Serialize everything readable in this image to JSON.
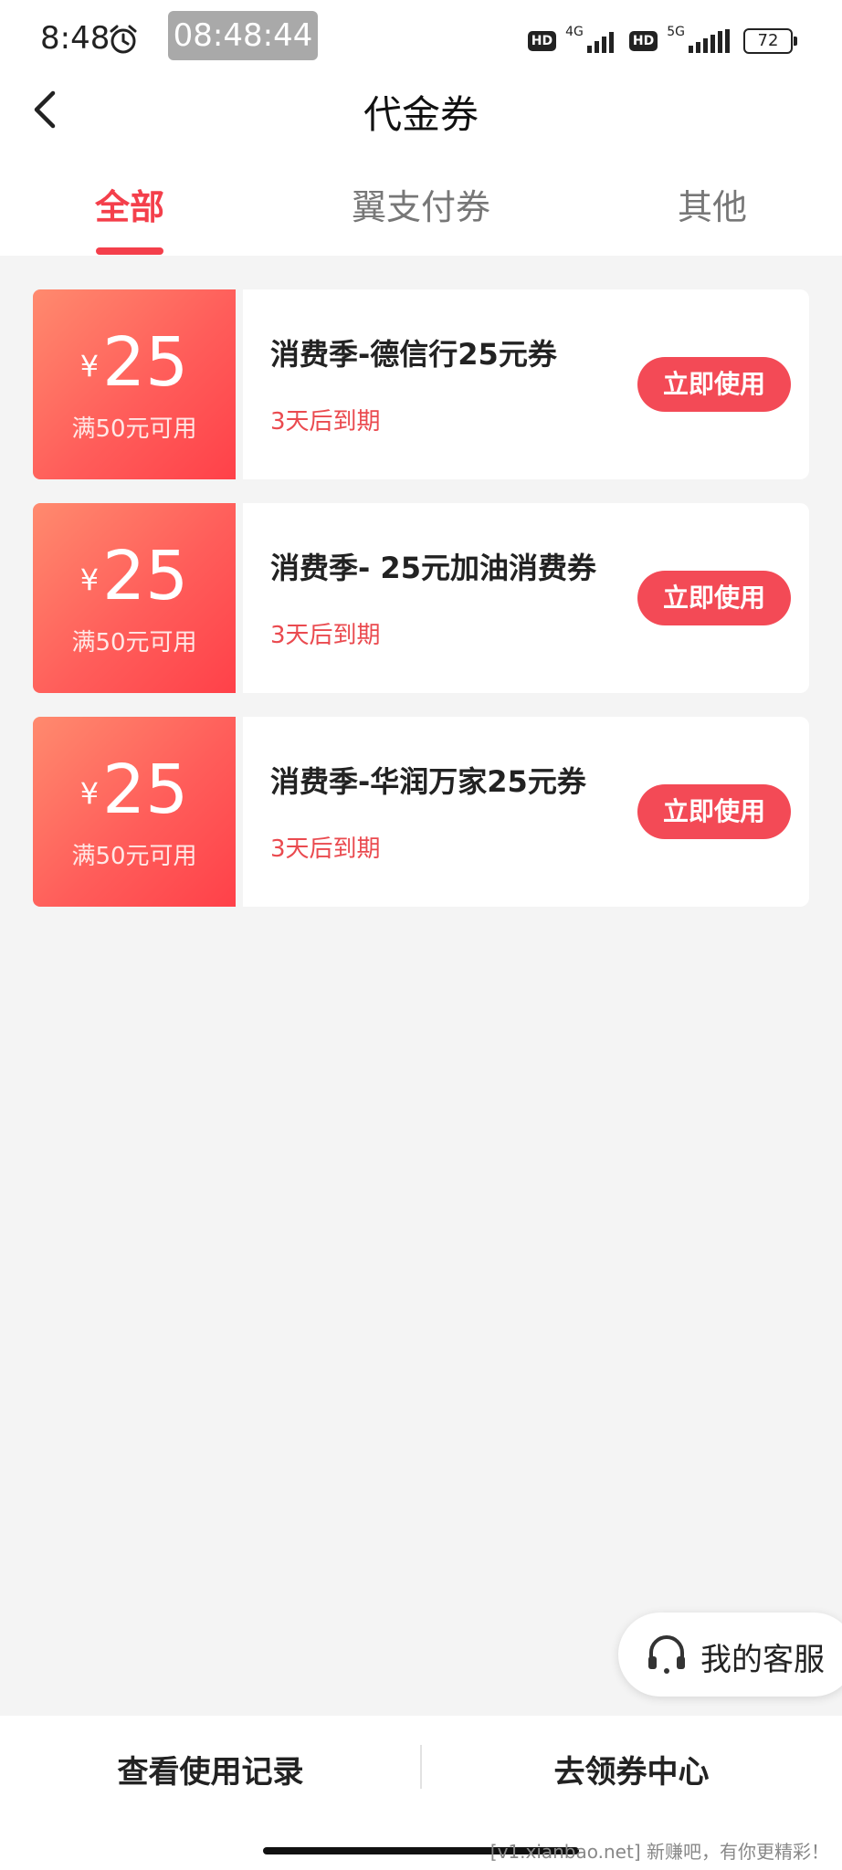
{
  "status_bar": {
    "time": "8:48",
    "clock_overlay": "08:48:44",
    "network_1": "4G",
    "network_2": "5G",
    "hd_label": "HD",
    "battery": "72"
  },
  "header": {
    "title": "代金券"
  },
  "tabs": [
    {
      "label": "全部",
      "active": true
    },
    {
      "label": "翼支付券",
      "active": false
    },
    {
      "label": "其他",
      "active": false
    }
  ],
  "coupons": [
    {
      "currency": "¥",
      "amount": "25",
      "condition": "满50元可用",
      "name": "消费季-德信行25元券",
      "expiry": "3天后到期",
      "button": "立即使用"
    },
    {
      "currency": "¥",
      "amount": "25",
      "condition": "满50元可用",
      "name": "消费季- 25元加油消费券",
      "expiry": "3天后到期",
      "button": "立即使用"
    },
    {
      "currency": "¥",
      "amount": "25",
      "condition": "满50元可用",
      "name": "消费季-华润万家25元券",
      "expiry": "3天后到期",
      "button": "立即使用"
    }
  ],
  "service": {
    "label": "我的客服"
  },
  "bottom_bar": {
    "left": "查看使用记录",
    "right": "去领券中心"
  },
  "watermark": "[v1.xianbao.net] 新赚吧，有你更精彩！",
  "colors": {
    "accent": "#f43f4b",
    "button": "#f34a56",
    "background": "#f4f4f4"
  }
}
